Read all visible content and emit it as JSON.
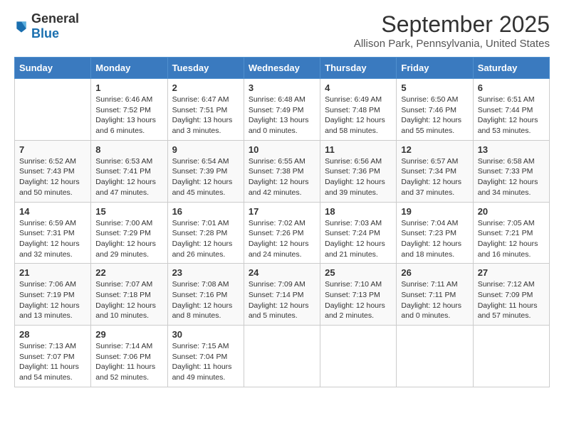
{
  "header": {
    "logo_general": "General",
    "logo_blue": "Blue",
    "title": "September 2025",
    "subtitle": "Allison Park, Pennsylvania, United States"
  },
  "days_of_week": [
    "Sunday",
    "Monday",
    "Tuesday",
    "Wednesday",
    "Thursday",
    "Friday",
    "Saturday"
  ],
  "weeks": [
    [
      {
        "day": "",
        "sunrise": "",
        "sunset": "",
        "daylight": ""
      },
      {
        "day": "1",
        "sunrise": "Sunrise: 6:46 AM",
        "sunset": "Sunset: 7:52 PM",
        "daylight": "Daylight: 13 hours and 6 minutes."
      },
      {
        "day": "2",
        "sunrise": "Sunrise: 6:47 AM",
        "sunset": "Sunset: 7:51 PM",
        "daylight": "Daylight: 13 hours and 3 minutes."
      },
      {
        "day": "3",
        "sunrise": "Sunrise: 6:48 AM",
        "sunset": "Sunset: 7:49 PM",
        "daylight": "Daylight: 13 hours and 0 minutes."
      },
      {
        "day": "4",
        "sunrise": "Sunrise: 6:49 AM",
        "sunset": "Sunset: 7:48 PM",
        "daylight": "Daylight: 12 hours and 58 minutes."
      },
      {
        "day": "5",
        "sunrise": "Sunrise: 6:50 AM",
        "sunset": "Sunset: 7:46 PM",
        "daylight": "Daylight: 12 hours and 55 minutes."
      },
      {
        "day": "6",
        "sunrise": "Sunrise: 6:51 AM",
        "sunset": "Sunset: 7:44 PM",
        "daylight": "Daylight: 12 hours and 53 minutes."
      }
    ],
    [
      {
        "day": "7",
        "sunrise": "Sunrise: 6:52 AM",
        "sunset": "Sunset: 7:43 PM",
        "daylight": "Daylight: 12 hours and 50 minutes."
      },
      {
        "day": "8",
        "sunrise": "Sunrise: 6:53 AM",
        "sunset": "Sunset: 7:41 PM",
        "daylight": "Daylight: 12 hours and 47 minutes."
      },
      {
        "day": "9",
        "sunrise": "Sunrise: 6:54 AM",
        "sunset": "Sunset: 7:39 PM",
        "daylight": "Daylight: 12 hours and 45 minutes."
      },
      {
        "day": "10",
        "sunrise": "Sunrise: 6:55 AM",
        "sunset": "Sunset: 7:38 PM",
        "daylight": "Daylight: 12 hours and 42 minutes."
      },
      {
        "day": "11",
        "sunrise": "Sunrise: 6:56 AM",
        "sunset": "Sunset: 7:36 PM",
        "daylight": "Daylight: 12 hours and 39 minutes."
      },
      {
        "day": "12",
        "sunrise": "Sunrise: 6:57 AM",
        "sunset": "Sunset: 7:34 PM",
        "daylight": "Daylight: 12 hours and 37 minutes."
      },
      {
        "day": "13",
        "sunrise": "Sunrise: 6:58 AM",
        "sunset": "Sunset: 7:33 PM",
        "daylight": "Daylight: 12 hours and 34 minutes."
      }
    ],
    [
      {
        "day": "14",
        "sunrise": "Sunrise: 6:59 AM",
        "sunset": "Sunset: 7:31 PM",
        "daylight": "Daylight: 12 hours and 32 minutes."
      },
      {
        "day": "15",
        "sunrise": "Sunrise: 7:00 AM",
        "sunset": "Sunset: 7:29 PM",
        "daylight": "Daylight: 12 hours and 29 minutes."
      },
      {
        "day": "16",
        "sunrise": "Sunrise: 7:01 AM",
        "sunset": "Sunset: 7:28 PM",
        "daylight": "Daylight: 12 hours and 26 minutes."
      },
      {
        "day": "17",
        "sunrise": "Sunrise: 7:02 AM",
        "sunset": "Sunset: 7:26 PM",
        "daylight": "Daylight: 12 hours and 24 minutes."
      },
      {
        "day": "18",
        "sunrise": "Sunrise: 7:03 AM",
        "sunset": "Sunset: 7:24 PM",
        "daylight": "Daylight: 12 hours and 21 minutes."
      },
      {
        "day": "19",
        "sunrise": "Sunrise: 7:04 AM",
        "sunset": "Sunset: 7:23 PM",
        "daylight": "Daylight: 12 hours and 18 minutes."
      },
      {
        "day": "20",
        "sunrise": "Sunrise: 7:05 AM",
        "sunset": "Sunset: 7:21 PM",
        "daylight": "Daylight: 12 hours and 16 minutes."
      }
    ],
    [
      {
        "day": "21",
        "sunrise": "Sunrise: 7:06 AM",
        "sunset": "Sunset: 7:19 PM",
        "daylight": "Daylight: 12 hours and 13 minutes."
      },
      {
        "day": "22",
        "sunrise": "Sunrise: 7:07 AM",
        "sunset": "Sunset: 7:18 PM",
        "daylight": "Daylight: 12 hours and 10 minutes."
      },
      {
        "day": "23",
        "sunrise": "Sunrise: 7:08 AM",
        "sunset": "Sunset: 7:16 PM",
        "daylight": "Daylight: 12 hours and 8 minutes."
      },
      {
        "day": "24",
        "sunrise": "Sunrise: 7:09 AM",
        "sunset": "Sunset: 7:14 PM",
        "daylight": "Daylight: 12 hours and 5 minutes."
      },
      {
        "day": "25",
        "sunrise": "Sunrise: 7:10 AM",
        "sunset": "Sunset: 7:13 PM",
        "daylight": "Daylight: 12 hours and 2 minutes."
      },
      {
        "day": "26",
        "sunrise": "Sunrise: 7:11 AM",
        "sunset": "Sunset: 7:11 PM",
        "daylight": "Daylight: 12 hours and 0 minutes."
      },
      {
        "day": "27",
        "sunrise": "Sunrise: 7:12 AM",
        "sunset": "Sunset: 7:09 PM",
        "daylight": "Daylight: 11 hours and 57 minutes."
      }
    ],
    [
      {
        "day": "28",
        "sunrise": "Sunrise: 7:13 AM",
        "sunset": "Sunset: 7:07 PM",
        "daylight": "Daylight: 11 hours and 54 minutes."
      },
      {
        "day": "29",
        "sunrise": "Sunrise: 7:14 AM",
        "sunset": "Sunset: 7:06 PM",
        "daylight": "Daylight: 11 hours and 52 minutes."
      },
      {
        "day": "30",
        "sunrise": "Sunrise: 7:15 AM",
        "sunset": "Sunset: 7:04 PM",
        "daylight": "Daylight: 11 hours and 49 minutes."
      },
      {
        "day": "",
        "sunrise": "",
        "sunset": "",
        "daylight": ""
      },
      {
        "day": "",
        "sunrise": "",
        "sunset": "",
        "daylight": ""
      },
      {
        "day": "",
        "sunrise": "",
        "sunset": "",
        "daylight": ""
      },
      {
        "day": "",
        "sunrise": "",
        "sunset": "",
        "daylight": ""
      }
    ]
  ]
}
